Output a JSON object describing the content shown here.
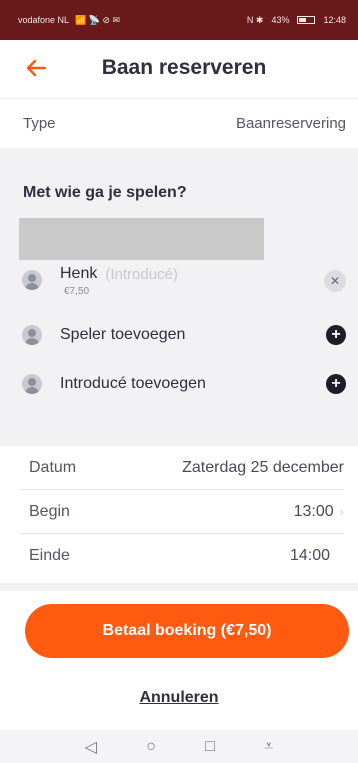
{
  "statusbar": {
    "carrier": "vodafone NL",
    "signal_icons": "📶 📡 ⊘ ✉",
    "right_icons": "N ✱",
    "battery": "43%",
    "time": "12:48"
  },
  "header": {
    "title": "Baan reserveren"
  },
  "type_row": {
    "label": "Type",
    "value": "Baanreservering"
  },
  "players": {
    "title": "Met wie ga je spelen?",
    "list": [
      {
        "name": "Henk",
        "tag": "(Introducé)",
        "price": "€7,50"
      }
    ],
    "add_player": "Speler toevoegen",
    "add_guest": "Introducé toevoegen"
  },
  "details": [
    {
      "label": "Datum",
      "value": "Zaterdag 25 december"
    },
    {
      "label": "Begin",
      "value": "13:00"
    },
    {
      "label": "Einde",
      "value": "14:00"
    }
  ],
  "actions": {
    "pay": "Betaal boeking (€7,50)",
    "cancel": "Annuleren"
  },
  "colors": {
    "accent": "#ff5a10",
    "status_bar": "#6a1a1a"
  }
}
